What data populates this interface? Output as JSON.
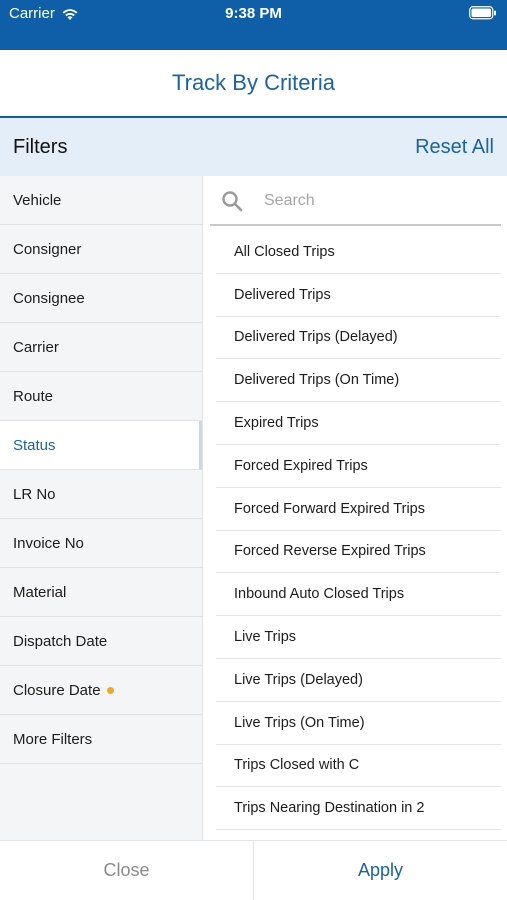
{
  "status_bar": {
    "carrier": "Carrier",
    "time": "9:38 PM"
  },
  "header": {
    "title": "Track By Criteria"
  },
  "filters": {
    "label": "Filters",
    "reset_label": "Reset All"
  },
  "sidebar": {
    "items": [
      {
        "label": "Vehicle"
      },
      {
        "label": "Consigner"
      },
      {
        "label": "Consignee"
      },
      {
        "label": "Carrier"
      },
      {
        "label": "Route"
      },
      {
        "label": "Status",
        "active": true
      },
      {
        "label": "LR No"
      },
      {
        "label": "Invoice No"
      },
      {
        "label": "Material"
      },
      {
        "label": "Dispatch Date"
      },
      {
        "label": "Closure Date",
        "indicator": true
      },
      {
        "label": "More Filters"
      }
    ]
  },
  "search": {
    "placeholder": "Search",
    "value": ""
  },
  "status_options": [
    "All Closed Trips",
    "Delivered Trips",
    "Delivered Trips (Delayed)",
    "Delivered Trips (On Time)",
    "Expired Trips",
    "Forced Expired Trips",
    "Forced Forward Expired Trips",
    "Forced Reverse Expired Trips",
    "Inbound Auto Closed Trips",
    "Live Trips",
    "Live Trips (Delayed)",
    "Live Trips (On Time)",
    "Trips Closed with C",
    "Trips Nearing Destination in 2"
  ],
  "footer": {
    "close_label": "Close",
    "apply_label": "Apply"
  },
  "colors": {
    "brand": "#0e5fa8",
    "accent": "#1a63a4",
    "indicator": "#f5a623",
    "header_bg": "#e3eef8"
  }
}
